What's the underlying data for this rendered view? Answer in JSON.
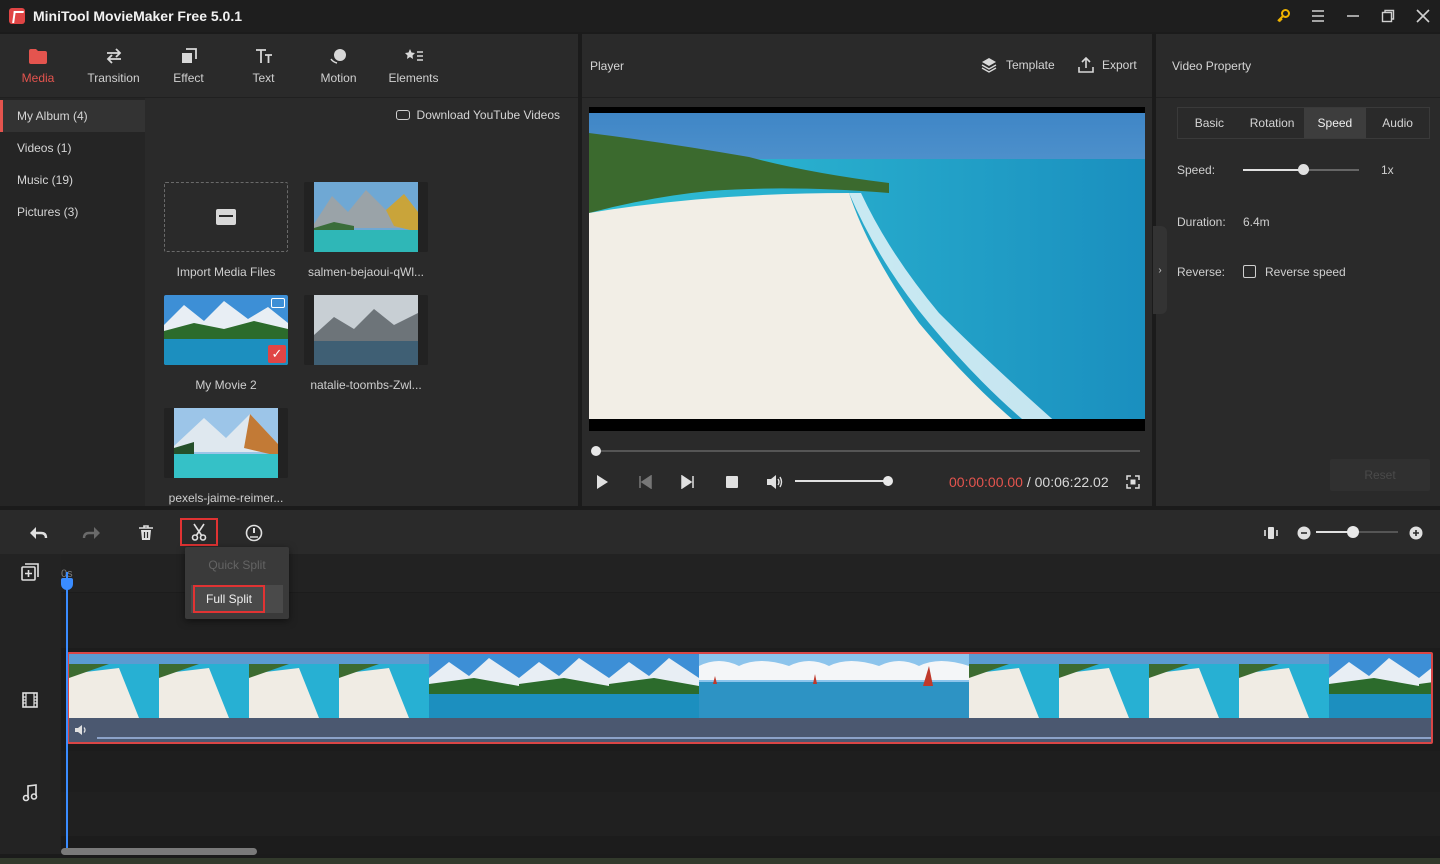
{
  "app": {
    "title": "MiniTool MovieMaker Free 5.0.1"
  },
  "media_tabs": [
    {
      "label": "Media",
      "icon": "folder-icon",
      "active": true
    },
    {
      "label": "Transition",
      "icon": "transition-icon"
    },
    {
      "label": "Effect",
      "icon": "effect-icon"
    },
    {
      "label": "Text",
      "icon": "text-icon"
    },
    {
      "label": "Motion",
      "icon": "motion-icon"
    },
    {
      "label": "Elements",
      "icon": "elements-icon"
    }
  ],
  "album": [
    {
      "label": "My Album (4)",
      "active": true
    },
    {
      "label": "Videos (1)"
    },
    {
      "label": "Music (19)"
    },
    {
      "label": "Pictures (3)"
    }
  ],
  "download_link": "Download YouTube Videos",
  "media_items": [
    {
      "label": "Import Media Files"
    },
    {
      "label": "salmen-bejaoui-qWl..."
    },
    {
      "label": "My Movie 2"
    },
    {
      "label": "natalie-toombs-Zwl..."
    },
    {
      "label": "pexels-jaime-reimer..."
    }
  ],
  "player": {
    "title": "Player",
    "template_label": "Template",
    "export_label": "Export",
    "time_current": "00:00:00.00",
    "time_separator": " / ",
    "time_total": "00:06:22.02"
  },
  "property": {
    "title": "Video Property",
    "tabs": [
      "Basic",
      "Rotation",
      "Speed",
      "Audio"
    ],
    "active_tab": "Speed",
    "speed_label": "Speed:",
    "speed_value": "1x",
    "duration_label": "Duration:",
    "duration_value": "6.4m",
    "reverse_label": "Reverse:",
    "reverse_checkbox": "Reverse speed",
    "reset_label": "Reset"
  },
  "timeline": {
    "ruler_start": "0s",
    "split_menu": {
      "quick_split": "Quick Split",
      "full_split": "Full Split"
    }
  },
  "colors": {
    "accent": "#e4544e",
    "playhead": "#3a8cff",
    "highlight_border": "#e03333"
  }
}
